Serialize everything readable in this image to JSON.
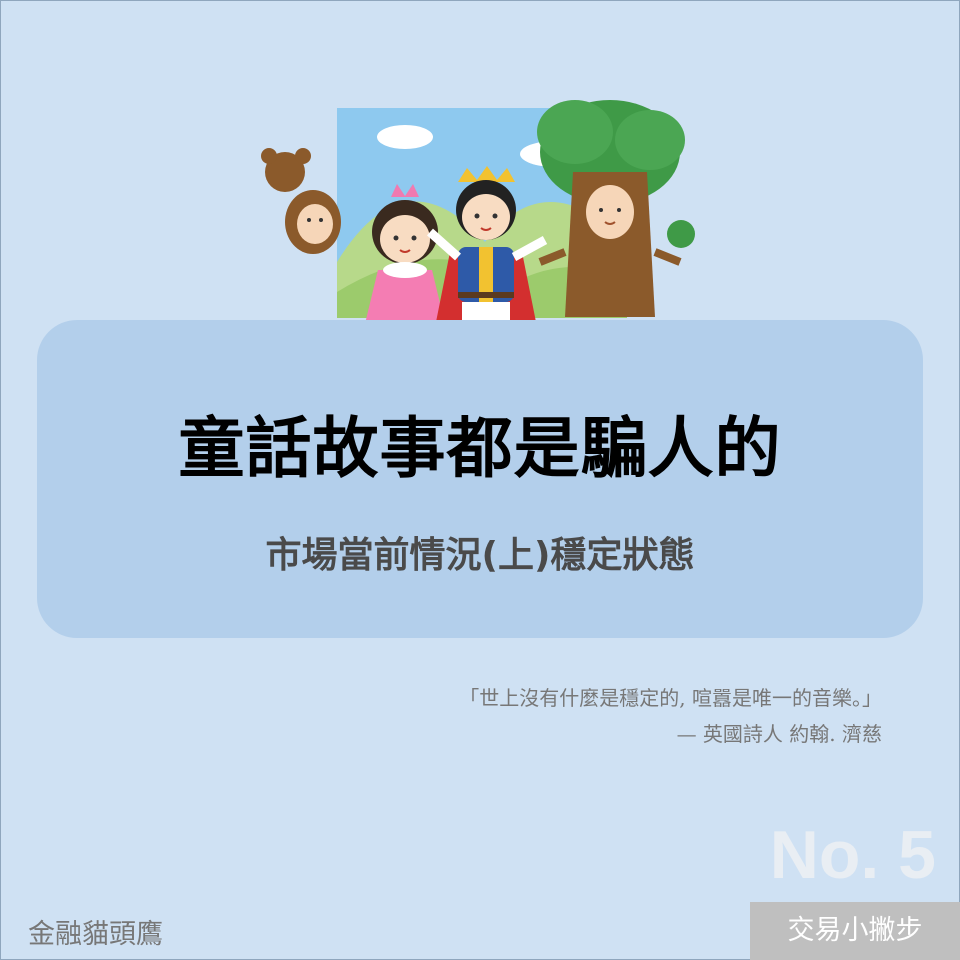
{
  "title": "童話故事都是騙人的",
  "subtitle": "市場當前情況(上)穩定狀態",
  "quote": {
    "text": "「世上沒有什麼是穩定的, 喧囂是唯一的音樂。」",
    "attribution": "— 英國詩人  約翰. 濟慈"
  },
  "issue": "No. 5",
  "brand": "金融貓頭鷹",
  "series": "交易小撇步",
  "colors": {
    "background": "#cfe1f3",
    "card": "#b3cfeb",
    "tag": "#bfbfbf"
  }
}
